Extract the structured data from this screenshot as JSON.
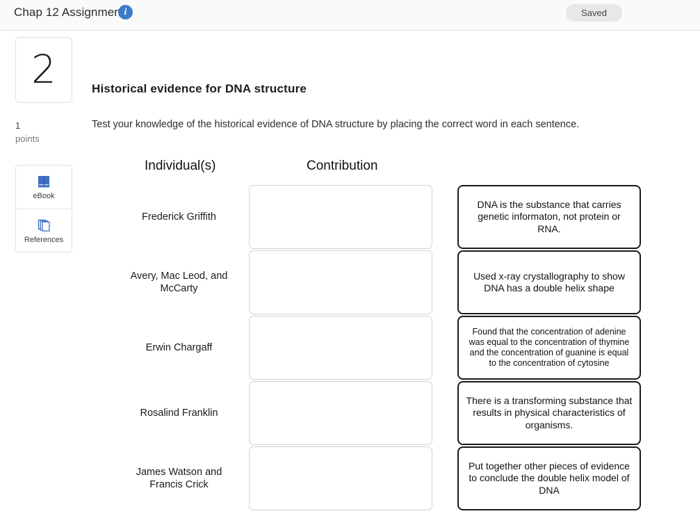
{
  "header": {
    "assignment_title": "Chap 12 Assignment",
    "info_icon": "info-icon",
    "info_glyph": "i",
    "saved_badge": "Saved"
  },
  "left_rail": {
    "question_number": "2",
    "points_value": "1",
    "points_label": "points",
    "tools": [
      {
        "label": "eBook",
        "icon": "book-icon"
      },
      {
        "label": "References",
        "icon": "pages-stack-icon"
      }
    ]
  },
  "question": {
    "title": "Historical evidence for DNA structure",
    "instructions": "Test your knowledge of the historical evidence of DNA structure by placing the correct word in each sentence.",
    "columns": {
      "individuals": "Individual(s)",
      "contribution": "Contribution"
    },
    "individuals": [
      "Frederick Griffith",
      "Avery, Mac Leod, and McCarty",
      "Erwin Chargaff",
      "Rosalind Franklin",
      "James Watson and Francis Crick"
    ],
    "dropzones": [
      "",
      "",
      "",
      "",
      ""
    ],
    "answer_cards": [
      "DNA is the substance that carries genetic informaton, not protein or RNA.",
      "Used x-ray crystallography to show DNA has a double helix shape",
      "Found that the concentration of adenine was equal to the concentration of thymine and the concentration of guanine is equal to the concentration of cytosine",
      "There is a transforming substance that results in physical characteristics of organisms.",
      "Put together other pieces of evidence to conclude the double helix model of DNA"
    ]
  },
  "colors": {
    "accent_blue": "#3d7cc9",
    "book_blue": "#3f6fc0",
    "header_bg": "#fafafa",
    "badge_bg": "#e8e8e8",
    "card_border": "#1a1a1a",
    "dropzone_border": "#d2d2d2"
  }
}
